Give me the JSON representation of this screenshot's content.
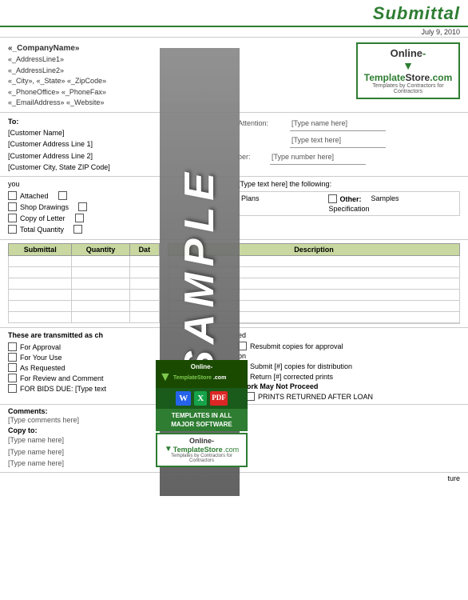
{
  "header": {
    "title": "Submittal",
    "date": "July 9, 2010"
  },
  "company": {
    "name": "«_CompanyName»",
    "address1": "«_AddressLine1»",
    "address2": "«_AddressLine2»",
    "cityStateZip": "«_City», «_State» «_ZipCode»",
    "phone": "«_PhoneOffice» «_PhoneFax»",
    "email": "«_EmailAddress» «_Website»"
  },
  "logo": {
    "line1": "Online-",
    "line2": "TemplateStore",
    "line3": ".com",
    "tagline": "Templates by Contractors for Contractors"
  },
  "to": {
    "label": "To:",
    "customer_name": "[Customer Name]",
    "address1": "[Customer Address Line 1]",
    "address2": "[Customer Address Line 2]",
    "cityStateZip": "[Customer City, State ZIP Code]",
    "attention_label": "Attention:",
    "attention_value": "[Type name here]",
    "type_text_here": "[Type text here]",
    "number_label": "ber:",
    "number_value": "[Type number here]"
  },
  "we_transmit": {
    "prefix_text": "you",
    "send_text": "[Type text here] the following:",
    "plans_label": "Plans",
    "other_label": "Other:",
    "samples_label": "Samples",
    "specification_label": "Specification"
  },
  "left_checks": {
    "items": [
      "Attached",
      "Shop Drawings",
      "Copy of Letter",
      "Total Quantity"
    ]
  },
  "table": {
    "headers": [
      "Submittal",
      "Quantity",
      "Dat"
    ],
    "rows": 6,
    "desc_header": "Description",
    "desc_rows": 6
  },
  "transmitted": {
    "header": "These are transmitted as ch",
    "items_left": [
      "For Approval",
      "For Your Use",
      "As Requested",
      "For Review and Comment",
      "FOR BIDS DUE: [Type text"
    ],
    "item_approved_suffix": "ed",
    "item_on_suffix": "on",
    "resubmit_label": "Resubmit copies for approval",
    "submit_label": "Submit [#] copies for distribution",
    "return_label": "Return [#] corrected prints",
    "work_notice": "/Work May Not Proceed",
    "prints_label": "PRINTS RETURNED AFTER LOAN"
  },
  "comments": {
    "label": "Comments:",
    "value": "[Type comments here]",
    "copy_to_label": "Copy to:",
    "copy_to_values": [
      "[Type name here]",
      "[Type name here]",
      "[Type name here]"
    ]
  },
  "signature": {
    "suffix": "ture"
  },
  "sample": {
    "text": "SAMPLE"
  },
  "ad": {
    "bottom_text": "TEMPLATES IN ALL\nMAJOR SOFTWARE",
    "logo_online": "Online-",
    "logo_template": "TemplateStore",
    "logo_dotcom": ".com",
    "logo_tagline": "Templates by Contractors for Contractors"
  }
}
